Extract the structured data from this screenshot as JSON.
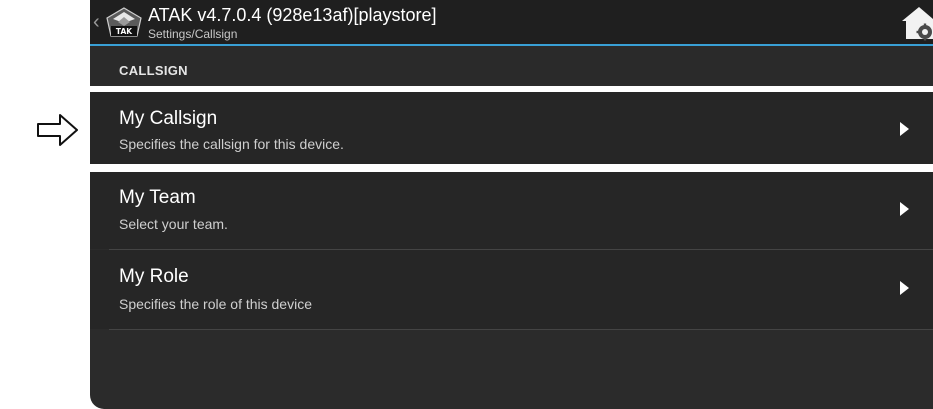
{
  "app_bar": {
    "back_glyph": "‹",
    "title": "ATAK v4.7.0.4 (928e13af)[playstore]",
    "breadcrumb": "Settings/Callsign",
    "logo_text": "TAK"
  },
  "section": {
    "title": "CALLSIGN"
  },
  "items": [
    {
      "title": "My Callsign",
      "subtitle": "Specifies the callsign for this device."
    },
    {
      "title": "My Team",
      "subtitle": "Select your team."
    },
    {
      "title": "My Role",
      "subtitle": "Specifies the role of this device"
    }
  ],
  "colors": {
    "accent": "#39a0d6",
    "background": "#2b2b2b",
    "titlebar": "#1f1f1f",
    "highlight_border": "#ffffff"
  },
  "icons": {
    "annotation": "hollow-right-arrow-icon",
    "back": "chevron-left-icon",
    "logo": "tak-logo-icon",
    "home": "home-settings-icon",
    "item_arrow": "triangle-right-icon"
  }
}
